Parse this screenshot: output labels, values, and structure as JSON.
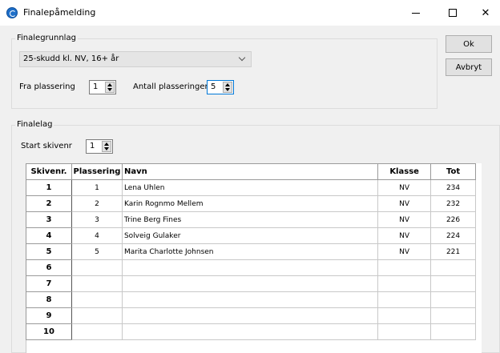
{
  "window": {
    "title": "Finalepåmelding",
    "minimize_label": "–",
    "close_label": "✕"
  },
  "finalegrunnlag": {
    "legend": "Finalegrunnlag",
    "class_selected": "25-skudd kl. NV, 16+ år",
    "fra_plassering_label": "Fra plassering",
    "fra_plassering_value": "1",
    "antall_plasseringer_label": "Antall plasseringer",
    "antall_plasseringer_value": "5"
  },
  "buttons": {
    "ok": "Ok",
    "avbryt": "Avbryt"
  },
  "finalelag": {
    "legend": "Finalelag",
    "start_skivenr_label": "Start skivenr",
    "start_skivenr_value": "1"
  },
  "table": {
    "headers": [
      "Skivenr.",
      "Plassering",
      "Navn",
      "Klasse",
      "Tot"
    ],
    "rows": [
      [
        "1",
        "1",
        "Lena Uhlen",
        "NV",
        "234"
      ],
      [
        "2",
        "2",
        "Karin Rognmo Mellem",
        "NV",
        "232"
      ],
      [
        "3",
        "3",
        "Trine Berg Fines",
        "NV",
        "226"
      ],
      [
        "4",
        "4",
        "Solveig Gulaker",
        "NV",
        "224"
      ],
      [
        "5",
        "5",
        "Marita Charlotte Johnsen",
        "NV",
        "221"
      ],
      [
        "6",
        "",
        "",
        "",
        ""
      ],
      [
        "7",
        "",
        "",
        "",
        ""
      ],
      [
        "8",
        "",
        "",
        "",
        ""
      ],
      [
        "9",
        "",
        "",
        "",
        ""
      ],
      [
        "10",
        "",
        "",
        "",
        ""
      ]
    ]
  }
}
